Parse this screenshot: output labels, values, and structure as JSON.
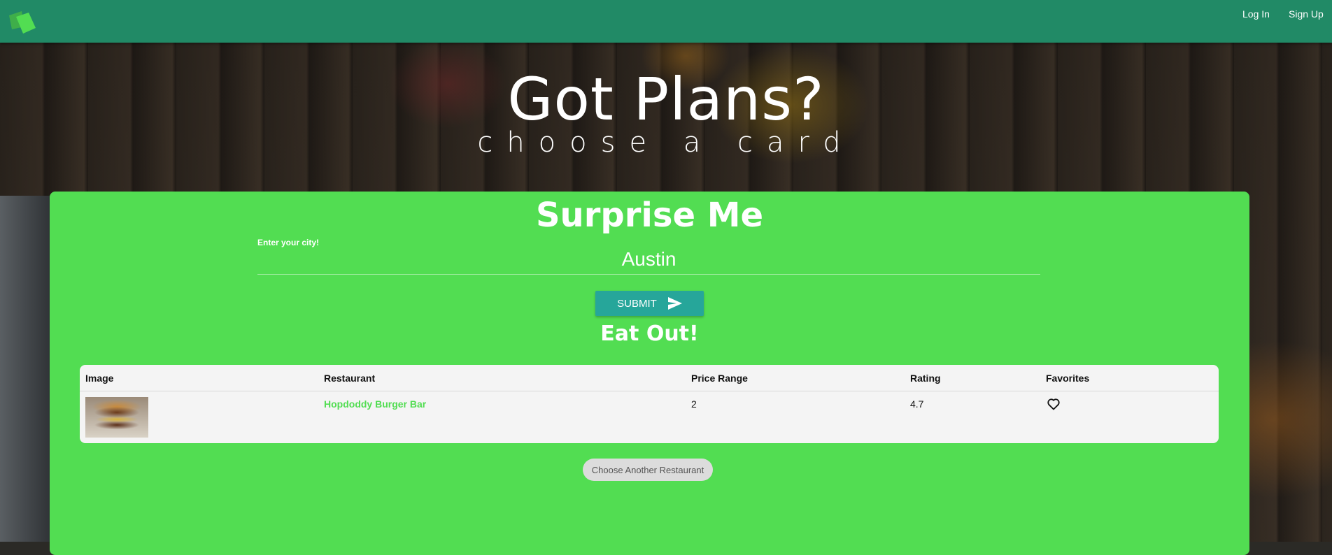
{
  "nav": {
    "login_label": "Log In",
    "signup_label": "Sign Up"
  },
  "hero": {
    "title": "Got Plans?",
    "subtitle": "choose a card"
  },
  "card": {
    "title": "Surprise Me",
    "city_label": "Enter your city!",
    "city_value": "Austin",
    "submit_label": "SUBMIT",
    "section_title": "Eat Out!",
    "another_label": "Choose Another Restaurant"
  },
  "table": {
    "headers": [
      "Image",
      "Restaurant",
      "Price Range",
      "Rating",
      "Favorites"
    ],
    "rows": [
      {
        "image": "burger photo",
        "restaurant": "Hopdoddy Burger Bar",
        "price_range": "2",
        "rating": "4.7",
        "favorite_icon": "heart-outline-icon"
      }
    ]
  },
  "colors": {
    "navbar": "#218a66",
    "card": "#52dd52",
    "submit": "#26a69a",
    "link": "#52dd52"
  }
}
